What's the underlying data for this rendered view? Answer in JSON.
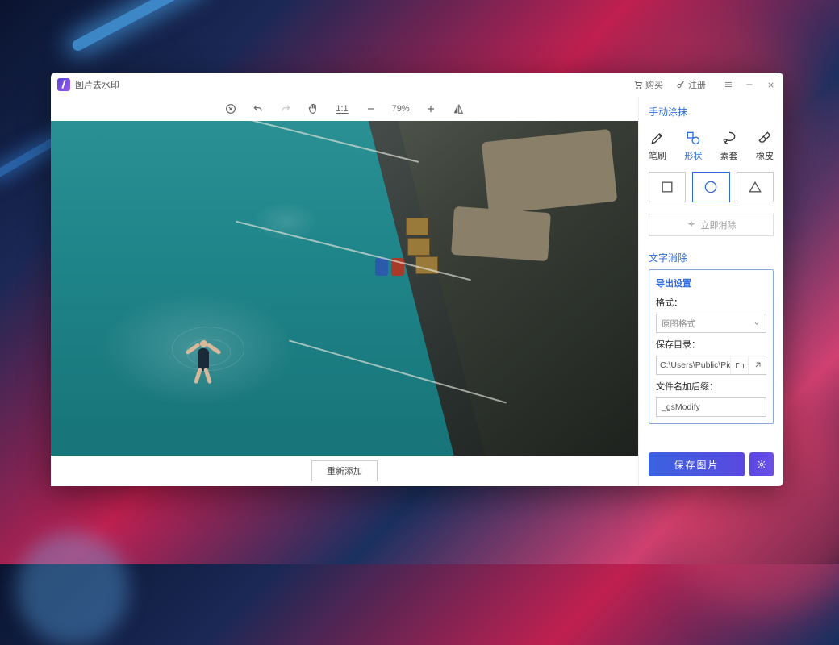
{
  "titlebar": {
    "app_title": "图片去水印",
    "buy": "购买",
    "register": "注册"
  },
  "toolbar": {
    "ratio_label": "1:1",
    "zoom": "79%"
  },
  "bottom": {
    "re_add": "重新添加"
  },
  "sidebar": {
    "manual_title": "手动涂抹",
    "brushes": {
      "brush": "笔刷",
      "shape": "形状",
      "lasso": "素套",
      "eraser": "橡皮"
    },
    "clear_now": "立即消除",
    "text_removal_title": "文字消除",
    "export": {
      "title": "导出设置",
      "format_label": "格式：",
      "format_value": "原图格式",
      "dir_label": "保存目录：",
      "dir_value": "C:\\Users\\Public\\Pictur",
      "suffix_label": "文件名加后缀：",
      "suffix_value": "_gsModify"
    },
    "save": "保存图片"
  }
}
